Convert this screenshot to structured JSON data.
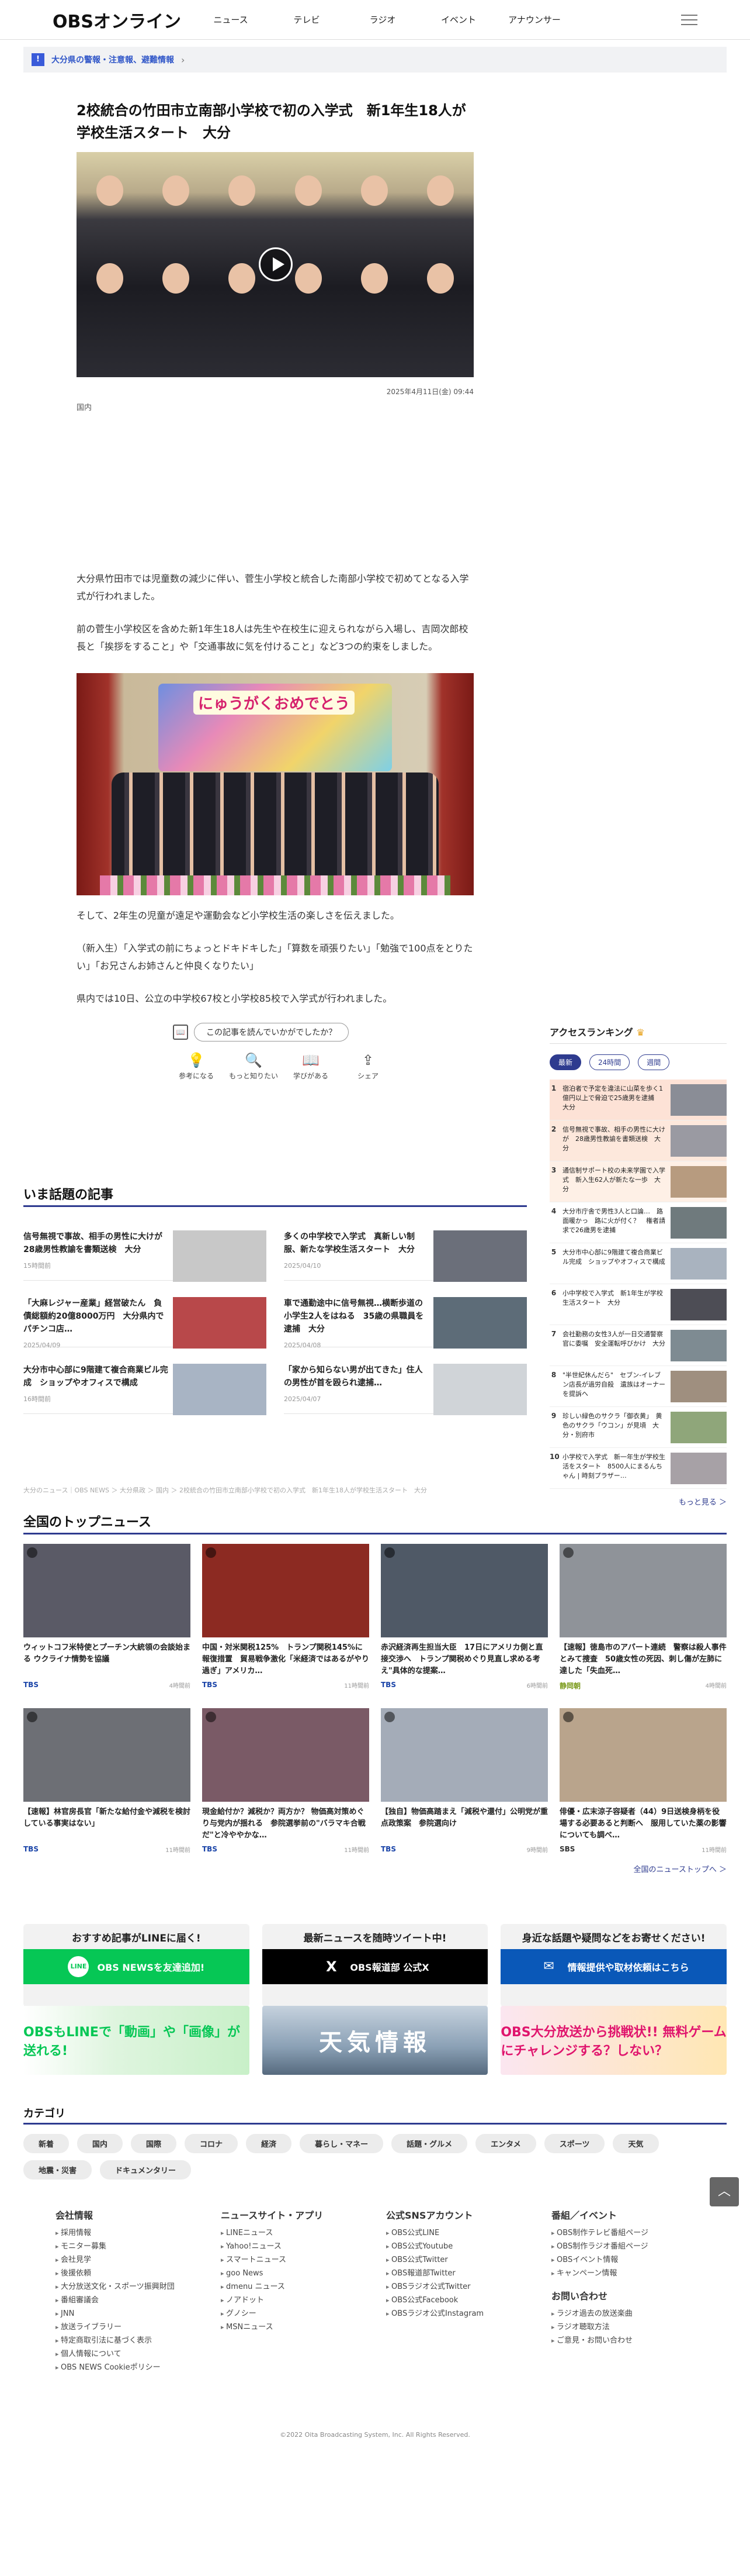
{
  "header": {
    "logo": "OBSオンライン",
    "nav": [
      "ニュース",
      "テレビ",
      "ラジオ",
      "イベント",
      "アナウンサー"
    ]
  },
  "alert": {
    "badge": "!",
    "text": "大分県の警報・注意報、避難情報"
  },
  "article": {
    "title": "2校統合の竹田市立南部小学校で初の入学式　新1年生18人が学校生活スタート　大分",
    "date": "2025年4月11日(金) 09:44",
    "category": "国内",
    "paragraphs": [
      "大分県竹田市では児童数の減少に伴い、菅生小学校と統合した南部小学校で初めてとなる入学式が行われました。",
      "前の菅生小学校区を含めた新1年生18人は先生や在校生に迎えられながら入場し、吉岡次郎校長と「挨拶をすること」や「交通事故に気を付けること」など3つの約束をしました。",
      "そして、2年生の児童が遠足や運動会など小学校生活の楽しさを伝えました。",
      "（新入生）「入学式の前にちょっとドキドキした」「算数を頑張りたい」「勉強で100点をとりたい」「お兄さんお姉さんと仲良くなりたい」",
      "県内では10日、公立の中学校67校と小学校85校で入学式が行われました。"
    ],
    "photo_banner": "にゅうがくおめでとう",
    "ask": "この記事を読んでいかがでしたか？",
    "reactions": [
      "参考になる",
      "もっと知りたい",
      "学びがある",
      "シェア"
    ]
  },
  "hot": {
    "heading": "いま話題の記事",
    "items": [
      {
        "title": "信号無視で事故、相手の男性に大けが　28歳男性教諭を書類送検　大分",
        "time": "15時間前"
      },
      {
        "title": "多くの中学校で入学式　真新しい制服、新たな学校生活スタート　大分",
        "time": "2025/04/10"
      },
      {
        "title": "「大麻レジャー産業」経営破たん　負債総額約20億8000万円　大分県内でパチンコ店…",
        "time": "2025/04/09"
      },
      {
        "title": "車で通勤途中に信号無視…横断歩道の小学生2人をはねる　35歳の県職員を逮捕　大分",
        "time": "2025/04/08"
      },
      {
        "title": "大分市中心部に9階建て複合商業ビル完成　ショップやオフィスで構成",
        "time": "16時間前"
      },
      {
        "title": "「家から知らない男が出てきた」住人の男性が首を殴られ逮捕…",
        "time": "2025/04/07"
      }
    ]
  },
  "breadcrumb": "大分のニュース｜OBS NEWS ＞ 大分県政 ＞ 国内 ＞ 2校統合の竹田市立南部小学校で初の入学式　新1年生18人が学校生活スタート　大分",
  "ranking": {
    "heading": "アクセスランキング",
    "tabs": [
      "最新",
      "24時間",
      "週間"
    ],
    "items": [
      "宿泊者で予定を違法に山菜を歩く1億円以上で脅迫で25歳男を逮捕　大分",
      "信号無視で事故、相手の男性に大けが　28歳男性教諭を書類送検　大分",
      "通信制サポート校の未来学園で入学式　新入生62人が新たな一歩　大分",
      "大分市庁舎で男性3人と口論…　路面暖かっ　路に火が付く？　権者請求で26歳男を逮捕",
      "大分市中心部に9階建て複合商業ビル完成　ショップやオフィスで構成",
      "小中学校で入学式　新1年生が学校生活スタート　大分",
      "会社勤務の女性3人が一日交通警察官に委嘱　安全運転呼びかけ　大分",
      "\"半世紀休んだら\"　セブン-イレブン店長が過労自殺　遺族はオーナーを提訴へ",
      "珍しい緑色のサクラ「御衣黄」　黄色のサクラ「ウコン」が見頃　大分・別府市",
      "小学校で入学式　新一年生が学校生活をスタート　8500人にまるんちゃん | 時刻プラザー…"
    ],
    "more": "もっと見る ＞"
  },
  "topnews": {
    "heading": "全国のトップニュース",
    "items": [
      {
        "title": "ウィットコフ米特使とプーチン大統領の会談始まる ウクライナ情勢を協議",
        "src": "TBS",
        "ago": "4時間前"
      },
      {
        "title": "中国・対米関税125%　トランプ関税145%に報復措置　貿易戦争激化「米経済ではあるがやり過ぎ」アメリカ…",
        "src": "TBS",
        "ago": "11時間前"
      },
      {
        "title": "赤沢経済再生担当大臣　17日にアメリカ側と直接交渉へ　トランプ関税めぐり見直し求める考え\"具体的な提案…",
        "src": "TBS",
        "ago": "6時間前"
      },
      {
        "title": "【速報】徳島市のアパート連続　警察は殺人事件とみて捜査　50歳女性の死因、刺し傷が左肺に達した「失血死…",
        "src": "静岡朝",
        "ago": "4時間前"
      },
      {
        "title": "【速報】林官房長官「新たな給付金や減税を検討している事実はない」",
        "src": "TBS",
        "ago": "11時間前"
      },
      {
        "title": "現金給付か？減税か？両方か？ 物価高対策めぐり与党内が揺れる　参院選挙前の\"バラマキ合戦だ\"と冷ややかな…",
        "src": "TBS",
        "ago": "11時間前"
      },
      {
        "title": "【独自】物価高踏まえ「減税や還付」公明党が重点政策案　参院選向け",
        "src": "TBS",
        "ago": "9時間前"
      },
      {
        "title": "俳優・広末涼子容疑者（44）9日送検身柄を役場する必要あると判断へ　服用していた薬の影響についても調べ…",
        "src": "SBS",
        "ago": "11時間前"
      }
    ],
    "more": "全国のニューストップへ ＞"
  },
  "promos": [
    {
      "heading": "おすすめ記事がLINEに届く!",
      "button": "OBS NEWSを友達追加!",
      "icon": "LINE"
    },
    {
      "heading": "最新ニュースを随時ツイート中!",
      "button": "OBS報道部 公式X",
      "icon": "X"
    },
    {
      "heading": "身近な話題や疑問などをお寄せください!",
      "button": "情報提供や取材依頼はこちら",
      "icon": "✉"
    }
  ],
  "banners": [
    "OBSもLINEで「動画」や「画像」が送れる!",
    "天気情報",
    "OBS大分放送から挑戦状!! 無料ゲームにチャレンジする？しない？"
  ],
  "categories": {
    "heading": "カテゴリ",
    "chips": [
      "新着",
      "国内",
      "国際",
      "コロナ",
      "経済",
      "暮らし・マネー",
      "話題・グルメ",
      "エンタメ",
      "スポーツ",
      "天気",
      "地震・災害",
      "ドキュメンタリー"
    ]
  },
  "footer": {
    "cols": [
      {
        "heading": "会社情報",
        "items": [
          "採用情報",
          "モニター募集",
          "会社見学",
          "後援依頼",
          "大分放送文化・スポーツ振興財団",
          "番組審議会",
          "JNN",
          "放送ライブラリー",
          "特定商取引法に基づく表示",
          "個人情報について",
          "OBS NEWS Cookieポリシー"
        ]
      },
      {
        "heading": "ニュースサイト・アプリ",
        "items": [
          "LINEニュース",
          "Yahoo!ニュース",
          "スマートニュース",
          "goo News",
          "dmenu ニュース",
          "ノアドット",
          "グノシー",
          "MSNニュース"
        ]
      },
      {
        "heading": "公式SNSアカウント",
        "items": [
          "OBS公式LINE",
          "OBS公式Youtube",
          "OBS公式Twitter",
          "OBS報道部Twitter",
          "OBSラジオ公式Twitter",
          "OBS公式Facebook",
          "OBSラジオ公式Instagram"
        ]
      },
      {
        "heading": "番組／イベント",
        "items": [
          "OBS制作テレビ番組ページ",
          "OBS制作ラジオ番組ページ",
          "OBSイベント情報",
          "キャンペーン情報"
        ]
      }
    ],
    "contact": {
      "heading": "お問い合わせ",
      "items": [
        "ラジオ過去の放送楽曲",
        "ラジオ聴取方法",
        "ご意見・お問い合わせ"
      ]
    },
    "copyright": "©2022 Oita Broadcasting System, Inc. All Rights Reserved."
  },
  "colors": {
    "accent": "#2e3b8f",
    "line": "#06c755",
    "alert": "#3a5bd9"
  }
}
